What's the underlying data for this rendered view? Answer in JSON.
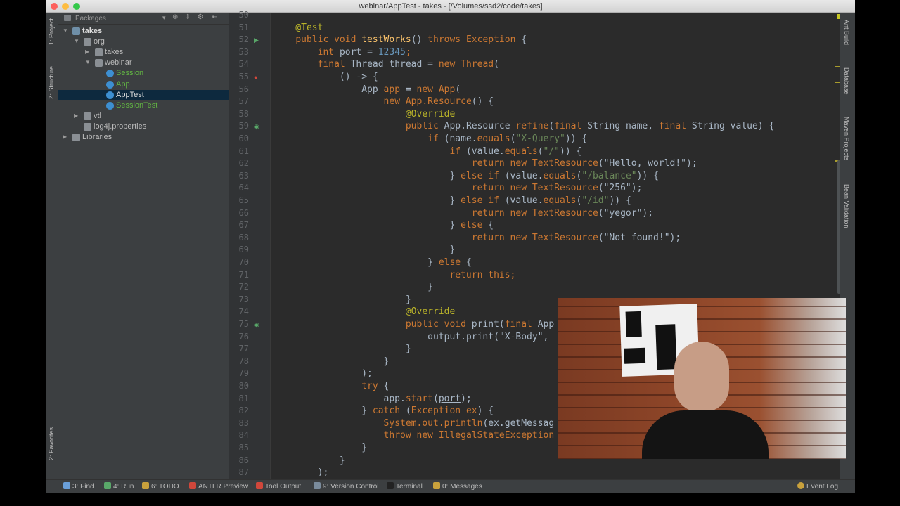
{
  "window": {
    "title": "webinar/AppTest - takes - [/Volumes/ssd2/code/takes]"
  },
  "left_stripe": {
    "tabs": [
      "1: Project",
      "Z: Structure",
      "2: Favorites"
    ]
  },
  "project": {
    "header_label": "Packages",
    "tree": [
      {
        "label": "takes",
        "depth": 0,
        "kind": "module",
        "expanded": true
      },
      {
        "label": "org",
        "depth": 1,
        "kind": "package",
        "expanded": true
      },
      {
        "label": "takes",
        "depth": 2,
        "kind": "package",
        "expanded": false
      },
      {
        "label": "webinar",
        "depth": 2,
        "kind": "package",
        "expanded": true
      },
      {
        "label": "Session",
        "depth": 3,
        "kind": "class"
      },
      {
        "label": "App",
        "depth": 3,
        "kind": "class"
      },
      {
        "label": "AppTest",
        "depth": 3,
        "kind": "test",
        "selected": true
      },
      {
        "label": "SessionTest",
        "depth": 3,
        "kind": "test"
      },
      {
        "label": "vtl",
        "depth": 1,
        "kind": "package",
        "expanded": false
      },
      {
        "label": "log4j.properties",
        "depth": 1,
        "kind": "file"
      },
      {
        "label": "Libraries",
        "depth": 0,
        "kind": "libraries",
        "expanded": false
      }
    ]
  },
  "editor": {
    "first_line": 50,
    "lines": [
      [
        {
          "t": "",
          "c": "p"
        }
      ],
      [
        {
          "t": "    @Test",
          "c": "ann"
        }
      ],
      [
        {
          "t": "    ",
          "c": "p"
        },
        {
          "t": "public void ",
          "c": "kw"
        },
        {
          "t": "testWorks",
          "c": "mth"
        },
        {
          "t": "() ",
          "c": "p"
        },
        {
          "t": "throws ",
          "c": "kw"
        },
        {
          "t": "Exception",
          "c": "kw"
        },
        {
          "t": " {",
          "c": "p"
        }
      ],
      [
        {
          "t": "        ",
          "c": "p"
        },
        {
          "t": "int ",
          "c": "kw"
        },
        {
          "t": "port = ",
          "c": "p"
        },
        {
          "t": "12345",
          "c": "num"
        },
        {
          "t": ";",
          "c": "kw"
        }
      ],
      [
        {
          "t": "        ",
          "c": "p"
        },
        {
          "t": "final ",
          "c": "kw"
        },
        {
          "t": "Thread thread = ",
          "c": "p"
        },
        {
          "t": "new ",
          "c": "kw"
        },
        {
          "t": "Thread",
          "c": "kw"
        },
        {
          "t": "(",
          "c": "p"
        }
      ],
      [
        {
          "t": "            () -> {",
          "c": "p"
        }
      ],
      [
        {
          "t": "                App ",
          "c": "p"
        },
        {
          "t": "app",
          "c": "kw"
        },
        {
          "t": " = ",
          "c": "p"
        },
        {
          "t": "new ",
          "c": "kw"
        },
        {
          "t": "App",
          "c": "kw"
        },
        {
          "t": "(",
          "c": "p"
        }
      ],
      [
        {
          "t": "                    ",
          "c": "p"
        },
        {
          "t": "new ",
          "c": "kw"
        },
        {
          "t": "App.Resource",
          "c": "kw"
        },
        {
          "t": "() {",
          "c": "p"
        }
      ],
      [
        {
          "t": "                        @Override",
          "c": "ann"
        }
      ],
      [
        {
          "t": "                        ",
          "c": "p"
        },
        {
          "t": "public ",
          "c": "kw"
        },
        {
          "t": "App.Resource ",
          "c": "p"
        },
        {
          "t": "refine",
          "c": "kw"
        },
        {
          "t": "(",
          "c": "p"
        },
        {
          "t": "final ",
          "c": "kw"
        },
        {
          "t": "String name, ",
          "c": "p"
        },
        {
          "t": "final ",
          "c": "kw"
        },
        {
          "t": "String value) {",
          "c": "p"
        }
      ],
      [
        {
          "t": "                            ",
          "c": "p"
        },
        {
          "t": "if ",
          "c": "kw"
        },
        {
          "t": "(name.",
          "c": "p"
        },
        {
          "t": "equals",
          "c": "kw"
        },
        {
          "t": "(",
          "c": "p"
        },
        {
          "t": "\"X-Query\"",
          "c": "str"
        },
        {
          "t": ")) {",
          "c": "p"
        }
      ],
      [
        {
          "t": "                                ",
          "c": "p"
        },
        {
          "t": "if ",
          "c": "kw"
        },
        {
          "t": "(value.",
          "c": "p"
        },
        {
          "t": "equals",
          "c": "kw"
        },
        {
          "t": "(",
          "c": "p"
        },
        {
          "t": "\"/\"",
          "c": "str"
        },
        {
          "t": ")) {",
          "c": "p"
        }
      ],
      [
        {
          "t": "                                    ",
          "c": "p"
        },
        {
          "t": "return new ",
          "c": "kw"
        },
        {
          "t": "TextResource",
          "c": "kw"
        },
        {
          "t": "(\"Hello, world!\");",
          "c": "p"
        }
      ],
      [
        {
          "t": "                                } ",
          "c": "p"
        },
        {
          "t": "else if ",
          "c": "kw"
        },
        {
          "t": "(value.",
          "c": "p"
        },
        {
          "t": "equals",
          "c": "kw"
        },
        {
          "t": "(",
          "c": "p"
        },
        {
          "t": "\"/balance\"",
          "c": "str"
        },
        {
          "t": ")) {",
          "c": "p"
        }
      ],
      [
        {
          "t": "                                    ",
          "c": "p"
        },
        {
          "t": "return new ",
          "c": "kw"
        },
        {
          "t": "TextResource",
          "c": "kw"
        },
        {
          "t": "(\"256\");",
          "c": "p"
        }
      ],
      [
        {
          "t": "                                } ",
          "c": "p"
        },
        {
          "t": "else if ",
          "c": "kw"
        },
        {
          "t": "(value.",
          "c": "p"
        },
        {
          "t": "equals",
          "c": "kw"
        },
        {
          "t": "(",
          "c": "p"
        },
        {
          "t": "\"/id\"",
          "c": "str"
        },
        {
          "t": ")) {",
          "c": "p"
        }
      ],
      [
        {
          "t": "                                    ",
          "c": "p"
        },
        {
          "t": "return new ",
          "c": "kw"
        },
        {
          "t": "TextResource",
          "c": "kw"
        },
        {
          "t": "(\"yegor\");",
          "c": "p"
        }
      ],
      [
        {
          "t": "                                } ",
          "c": "p"
        },
        {
          "t": "else ",
          "c": "kw"
        },
        {
          "t": "{",
          "c": "p"
        }
      ],
      [
        {
          "t": "                                    ",
          "c": "p"
        },
        {
          "t": "return new ",
          "c": "kw"
        },
        {
          "t": "TextResource",
          "c": "kw"
        },
        {
          "t": "(\"Not found!\");",
          "c": "p"
        }
      ],
      [
        {
          "t": "                                }",
          "c": "p"
        }
      ],
      [
        {
          "t": "                            } ",
          "c": "p"
        },
        {
          "t": "else ",
          "c": "kw"
        },
        {
          "t": "{",
          "c": "p"
        }
      ],
      [
        {
          "t": "                                ",
          "c": "p"
        },
        {
          "t": "return this",
          "c": "kw"
        },
        {
          "t": ";",
          "c": "kw"
        }
      ],
      [
        {
          "t": "                            }",
          "c": "p"
        }
      ],
      [
        {
          "t": "                        }",
          "c": "p"
        }
      ],
      [
        {
          "t": "                        @Override",
          "c": "ann"
        }
      ],
      [
        {
          "t": "                        ",
          "c": "p"
        },
        {
          "t": "public void ",
          "c": "kw"
        },
        {
          "t": "print",
          "c": "p"
        },
        {
          "t": "(",
          "c": "p"
        },
        {
          "t": "final ",
          "c": "kw"
        },
        {
          "t": "App",
          "c": "p"
        }
      ],
      [
        {
          "t": "                            output.",
          "c": "p"
        },
        {
          "t": "print",
          "c": "p"
        },
        {
          "t": "(\"X-Body\",",
          "c": "p"
        }
      ],
      [
        {
          "t": "                        }",
          "c": "p"
        }
      ],
      [
        {
          "t": "                    }",
          "c": "p"
        }
      ],
      [
        {
          "t": "                );",
          "c": "p"
        }
      ],
      [
        {
          "t": "                ",
          "c": "p"
        },
        {
          "t": "try ",
          "c": "kw"
        },
        {
          "t": "{",
          "c": "p"
        }
      ],
      [
        {
          "t": "                    app.",
          "c": "p"
        },
        {
          "t": "start",
          "c": "kw"
        },
        {
          "t": "(",
          "c": "p"
        },
        {
          "t": "port",
          "c": "ul"
        },
        {
          "t": ");",
          "c": "p"
        }
      ],
      [
        {
          "t": "                } ",
          "c": "p"
        },
        {
          "t": "catch ",
          "c": "kw"
        },
        {
          "t": "(",
          "c": "p"
        },
        {
          "t": "Exception ",
          "c": "kw"
        },
        {
          "t": "ex",
          "c": "kw"
        },
        {
          "t": ") {",
          "c": "p"
        }
      ],
      [
        {
          "t": "                    ",
          "c": "p"
        },
        {
          "t": "System.out.println",
          "c": "kw"
        },
        {
          "t": "(ex.",
          "c": "p"
        },
        {
          "t": "getMessag",
          "c": "p"
        }
      ],
      [
        {
          "t": "                    ",
          "c": "p"
        },
        {
          "t": "throw new ",
          "c": "kw"
        },
        {
          "t": "IllegalStateException",
          "c": "kw"
        }
      ],
      [
        {
          "t": "                }",
          "c": "p"
        }
      ],
      [
        {
          "t": "            }",
          "c": "p"
        }
      ],
      [
        {
          "t": "        );",
          "c": "p"
        }
      ]
    ],
    "gutter_marks": {
      "52": "run",
      "55": "error",
      "59": "override",
      "75": "override"
    }
  },
  "right_stripe": {
    "tabs": [
      "Ant Build",
      "Database",
      "Maven Projects",
      "Bean Validation"
    ]
  },
  "bottom_bar": {
    "tabs": [
      {
        "label": "3: Find",
        "icon": "search-icon",
        "color": "#6a9fd8"
      },
      {
        "label": "4: Run",
        "icon": "run-icon",
        "color": "#59a869"
      },
      {
        "label": "6: TODO",
        "icon": "todo-icon",
        "color": "#c9a13c"
      },
      {
        "label": "ANTLR Preview",
        "icon": "antlr-icon",
        "color": "#d0473b"
      },
      {
        "label": "Tool Output",
        "icon": "tool-output-icon",
        "color": "#d0473b"
      },
      {
        "label": "9: Version Control",
        "icon": "version-control-icon",
        "color": "#7a8b9c"
      },
      {
        "label": "Terminal",
        "icon": "terminal-icon",
        "color": "#222222"
      },
      {
        "label": "0: Messages",
        "icon": "messages-icon",
        "color": "#c9a13c"
      }
    ],
    "event_log": "Event Log"
  },
  "colors": {
    "keyword": "#cc7832",
    "string": "#6a8759",
    "annotation": "#bbb529",
    "number": "#6897bb",
    "method": "#ffc66d",
    "text": "#a9b7c6",
    "background": "#2b2b2b"
  }
}
